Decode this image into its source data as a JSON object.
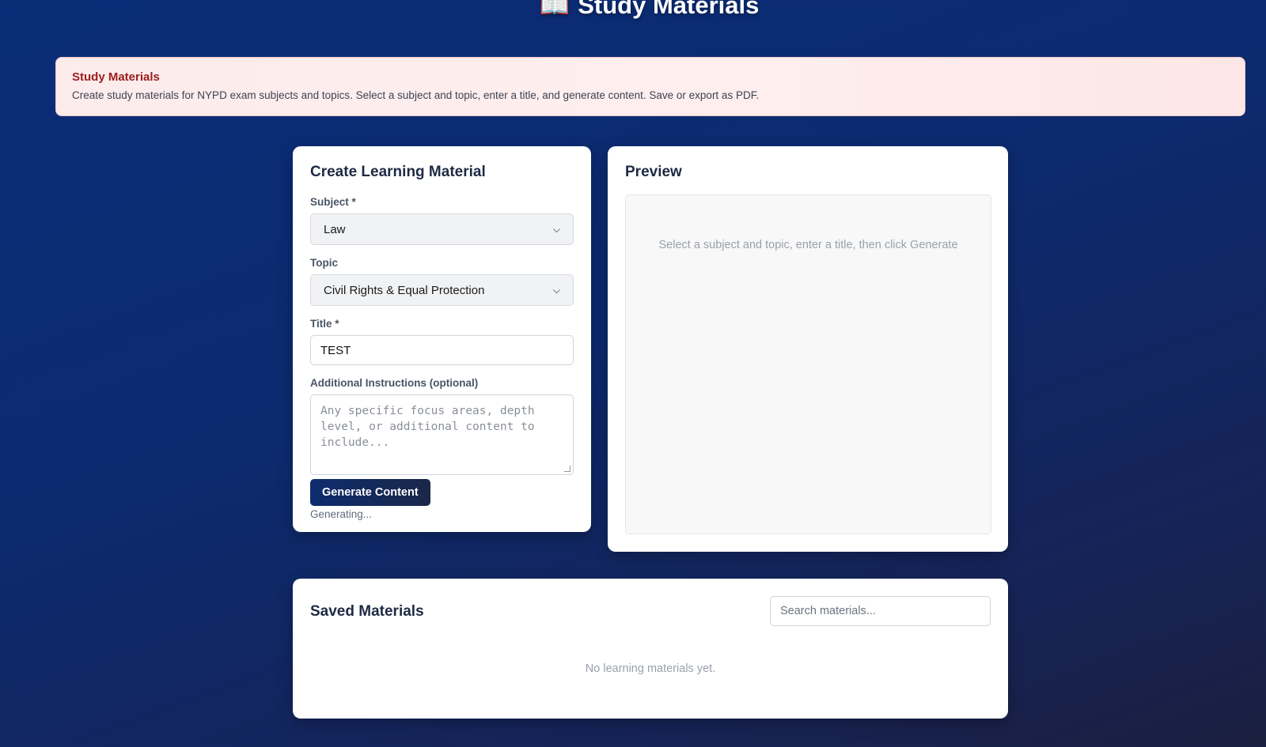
{
  "header": {
    "icon": "open-book-icon",
    "icon_glyph": "📖",
    "title": "Study Materials"
  },
  "banner": {
    "title": "Study Materials",
    "text": "Create study materials for NYPD exam subjects and topics. Select a subject and topic, enter a title, and generate content. Save or export as PDF."
  },
  "create": {
    "heading": "Create Learning Material",
    "subject_label": "Subject *",
    "subject_value": "Law",
    "topic_label": "Topic",
    "topic_value": "Civil Rights & Equal Protection",
    "title_label": "Title *",
    "title_value": "TEST",
    "instructions_label": "Additional Instructions (optional)",
    "instructions_placeholder": "Any specific focus areas, depth level, or additional content to include...",
    "generate_label": "Generate Content",
    "status": "Generating..."
  },
  "preview": {
    "heading": "Preview",
    "placeholder": "Select a subject and topic, enter a title, then click Generate"
  },
  "saved": {
    "heading": "Saved Materials",
    "search_placeholder": "Search materials...",
    "empty_text": "No learning materials yet."
  },
  "colors": {
    "background": "#0c2a6e",
    "banner_bg": "#fdecec",
    "banner_title": "#9b1c1c",
    "button": "#0e2c6e"
  }
}
